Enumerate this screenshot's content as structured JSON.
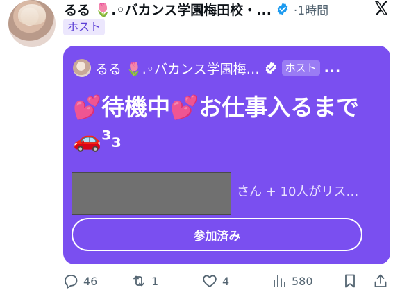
{
  "post": {
    "author_name": "るる 🌷.◦バカンス学園梅田校・...",
    "time": "·1時間",
    "badge": "ホスト"
  },
  "card": {
    "author_name": "るる 🌷.◦バカンス学園梅…",
    "badge": "ホスト",
    "more": "...",
    "title": "💕待機中💕お仕事入るまで🚗³₃",
    "listeners": "さん + 10人がリス…",
    "button_label": "参加済み",
    "color": "#7a4ff0"
  },
  "actions": {
    "replies": "46",
    "reposts": "1",
    "likes": "4",
    "views": "580"
  },
  "icons": {
    "verified": "verified-badge-icon",
    "brand": "x-logo-icon"
  }
}
